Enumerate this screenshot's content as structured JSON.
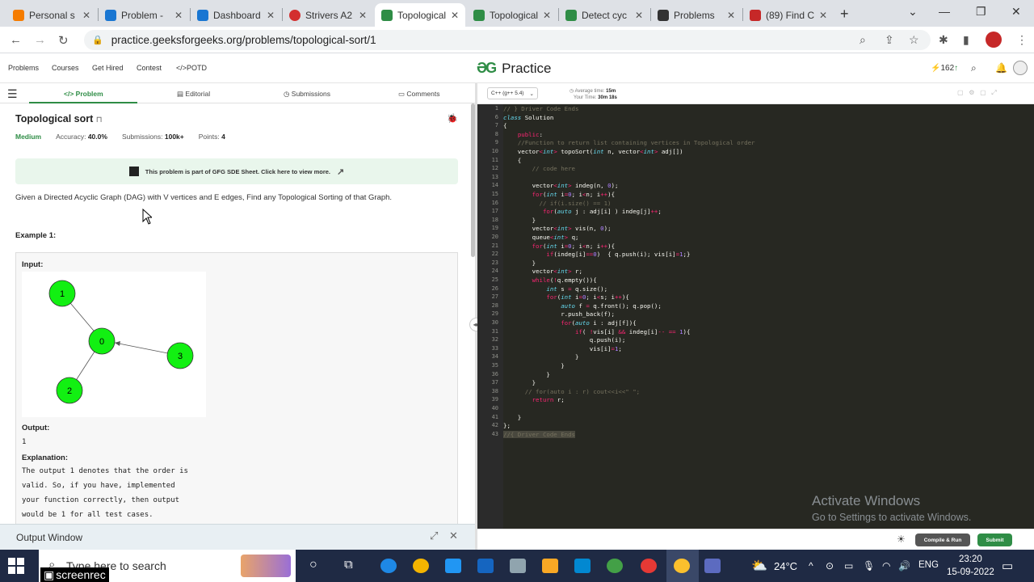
{
  "browser": {
    "tabs": [
      {
        "label": "Personal s",
        "color": "#f57c00"
      },
      {
        "label": "Problem -",
        "color": "#1976d2"
      },
      {
        "label": "Dashboard",
        "color": "#1976d2"
      },
      {
        "label": "Strivers A2",
        "color": "#d32f2f"
      },
      {
        "label": "Topological",
        "color": "#2f8d46"
      },
      {
        "label": "Topological",
        "color": "#2f8d46"
      },
      {
        "label": "Detect cyc",
        "color": "#2f8d46"
      },
      {
        "label": "Problems",
        "color": "#333333"
      },
      {
        "label": "(89) Find C",
        "color": "#c62828"
      }
    ],
    "active_tab_index": 4,
    "url": "practice.geeksforgeeks.org/problems/topological-sort/1"
  },
  "gfg_nav": {
    "links": [
      "Problems",
      "Courses",
      "Get Hired",
      "Contest",
      "</>POTD"
    ],
    "logo_text": "Practice",
    "streak": "162"
  },
  "problem_tabs": [
    "</> Problem",
    "Editorial",
    "Submissions",
    "Comments"
  ],
  "problem": {
    "title": "Topological sort",
    "difficulty": "Medium",
    "accuracy_label": "Accuracy:",
    "accuracy": "40.0%",
    "submissions_label": "Submissions:",
    "submissions": "100k+",
    "points_label": "Points:",
    "points": "4",
    "banner": "This problem is part of GFG SDE Sheet. Click here to view more.",
    "description": "Given a Directed Acyclic Graph (DAG) with V vertices and E edges, Find any Topological Sorting of that Graph.",
    "example_title": "Example 1:",
    "input_label": "Input:",
    "graph_nodes": [
      "1",
      "0",
      "3",
      "2"
    ],
    "output_label": "Output:",
    "output_value": "1",
    "explanation_label": "Explanation:",
    "explanation_lines": [
      "The output 1 denotes that the order is",
      "valid. So, if you have, implemented",
      "your function correctly, then output",
      "would be 1 for all test cases."
    ]
  },
  "output_window": "Output Window",
  "editor": {
    "language": "C++ (g++ 5.4)",
    "avg_time_label": "Average time:",
    "avg_time": "15m",
    "your_time_label": "Your Time:",
    "your_time": "30m 18s",
    "compile_label": "Compile & Run",
    "submit_label": "Submit"
  },
  "watermark": {
    "line1": "Activate Windows",
    "line2": "Go to Settings to activate Windows."
  },
  "taskbar": {
    "search_placeholder": "Type here to search",
    "weather": "24°C",
    "language": "ENG",
    "time": "23:20",
    "date": "15-09-2022"
  },
  "recorder_label": "screenrec"
}
